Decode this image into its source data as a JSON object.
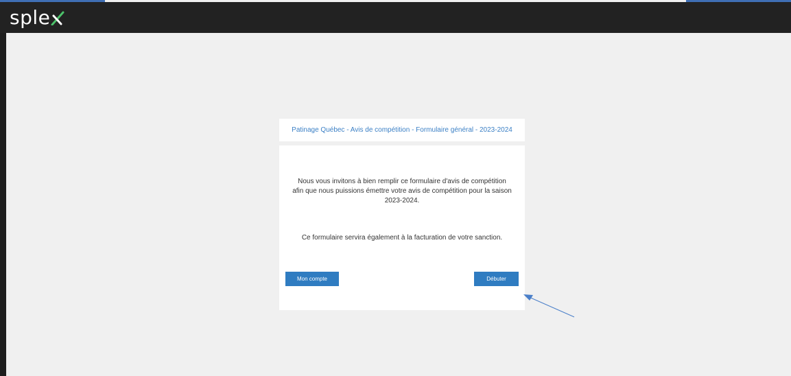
{
  "header": {
    "logo_text": "sple",
    "logo_accent_color": "#4cc26a",
    "bg_color": "#222222"
  },
  "form": {
    "title": "Patinage Québec - Avis de compétition - Formulaire général - 2023-2024",
    "intro_lines": [
      "Nous vous invitons à bien remplir ce formulaire d'avis de compétition",
      "afin que nous puissions émettre votre avis de compétition pour la saison",
      "2023-2024."
    ],
    "note": "Ce formulaire servira également à la facturation de votre sanction.",
    "account_button": "Mon compte",
    "start_button": "Débuter"
  },
  "colors": {
    "title_color": "#3a7fc5",
    "button_color": "#2f7cc1",
    "page_bg": "#f0f0f0",
    "annotation_arrow": "#4a7fc9"
  },
  "icons": {
    "annotation": "arrow-pointing-icon"
  }
}
